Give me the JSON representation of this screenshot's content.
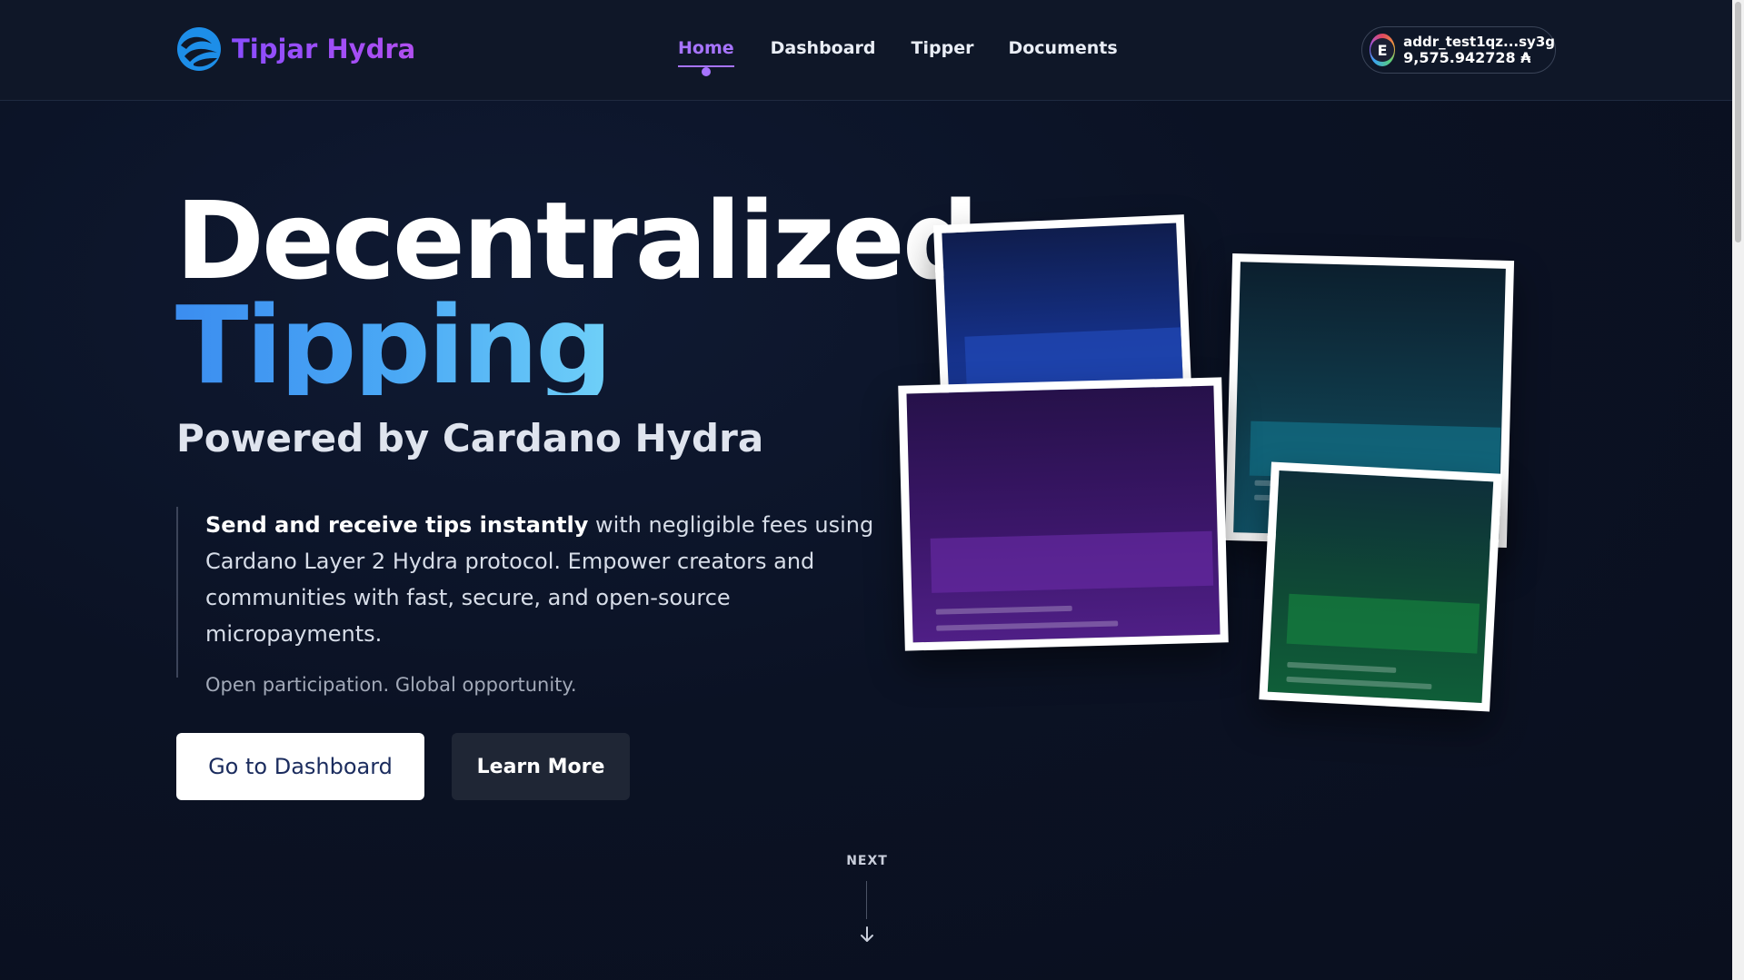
{
  "brand": {
    "name": "Tipjar Hydra",
    "logo_icon": "hydra-wave-logo-icon"
  },
  "nav": {
    "items": [
      {
        "label": "Home",
        "active": true
      },
      {
        "label": "Dashboard",
        "active": false
      },
      {
        "label": "Tipper",
        "active": false
      },
      {
        "label": "Documents",
        "active": false
      }
    ]
  },
  "wallet": {
    "address": "addr_test1qz...sy3g",
    "balance": "9,575.942728 ₳",
    "icon": "wallet-avatar-icon"
  },
  "hero": {
    "title_line1": "Decentralized",
    "title_line2": "Tipping",
    "subtitle": "Powered by Cardano Hydra",
    "desc_strong": "Send and receive tips instantly",
    "desc_rest": " with negligible fees using Cardano Layer 2 Hydra protocol. Empower creators and communities with fast, secure, and open-source micropayments.",
    "desc_sub": "Open participation. Global opportunity.",
    "primary_button": "Go to Dashboard",
    "secondary_button": "Learn More"
  },
  "scroll_hint": {
    "label": "NEXT",
    "icon": "arrow-down-icon"
  },
  "colors": {
    "background": "#0b1224",
    "accent_purple": "#a774ff",
    "accent_blue": "#4aa8f5",
    "card_blue": "#1b3a8f",
    "card_purple": "#4a1d7a",
    "card_teal": "#0f4a5c",
    "card_green": "#0f4a2c"
  }
}
